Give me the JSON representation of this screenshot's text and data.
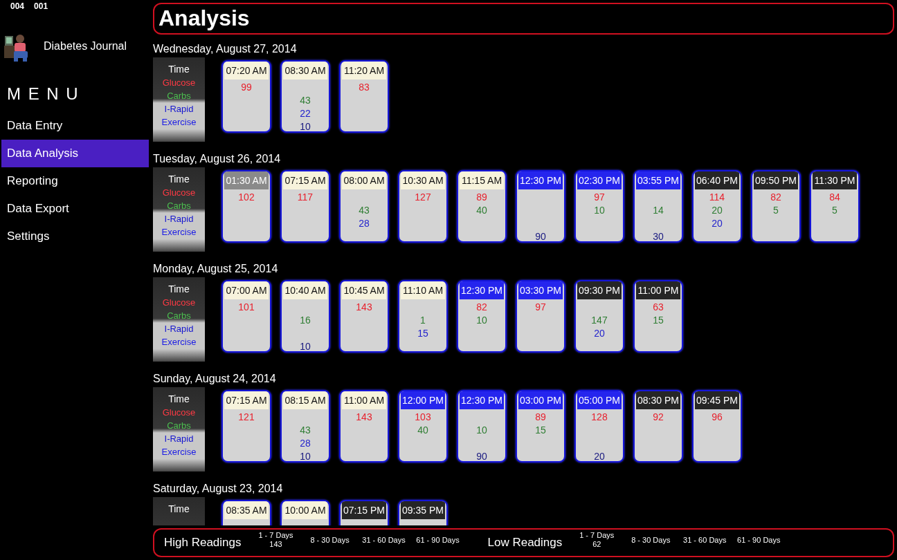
{
  "status_codes": [
    "004",
    "001"
  ],
  "app": {
    "title": "Diabetes Journal"
  },
  "menu": {
    "heading": "M E N U",
    "items": [
      {
        "label": "Data Entry",
        "selected": false
      },
      {
        "label": "Data Analysis",
        "selected": true
      },
      {
        "label": "Reporting",
        "selected": false
      },
      {
        "label": "Data Export",
        "selected": false
      },
      {
        "label": "Settings",
        "selected": false
      }
    ]
  },
  "page_title": "Analysis",
  "days": [
    {
      "date": "Wednesday, August 27, 2014",
      "legend": [
        {
          "kind": "time",
          "label": "Time"
        },
        {
          "kind": "glucose",
          "label": "Glucose"
        },
        {
          "kind": "carbs",
          "label": "Carbs"
        },
        {
          "kind": "irapid",
          "label": "I-Rapid"
        },
        {
          "kind": "exercise",
          "label": "Exercise"
        }
      ],
      "entries": [
        {
          "time": "07:20 AM",
          "kind": "morning",
          "glucose": "99"
        },
        {
          "time": "08:30 AM",
          "kind": "morning",
          "carbs": "43",
          "irapid": "22",
          "exercise": "10"
        },
        {
          "time": "11:20 AM",
          "kind": "morning",
          "glucose": "83"
        }
      ]
    },
    {
      "date": "Tuesday, August 26, 2014",
      "legend": [
        {
          "kind": "time",
          "label": "Time"
        },
        {
          "kind": "glucose",
          "label": "Glucose"
        },
        {
          "kind": "carbs",
          "label": "Carbs"
        },
        {
          "kind": "irapid",
          "label": "I-Rapid"
        },
        {
          "kind": "exercise",
          "label": "Exercise"
        }
      ],
      "entries": [
        {
          "time": "01:30 AM",
          "kind": "night",
          "glucose": "102"
        },
        {
          "time": "07:15 AM",
          "kind": "morning",
          "glucose": "117"
        },
        {
          "time": "08:00 AM",
          "kind": "morning",
          "carbs": "43",
          "irapid": "28"
        },
        {
          "time": "10:30 AM",
          "kind": "morning",
          "glucose": "127"
        },
        {
          "time": "11:15 AM",
          "kind": "morning",
          "glucose": "89",
          "carbs": "40"
        },
        {
          "time": "12:30 PM",
          "kind": "afternoon",
          "exercise": "90"
        },
        {
          "time": "02:30 PM",
          "kind": "afternoon",
          "glucose": "97",
          "carbs": "10"
        },
        {
          "time": "03:55 PM",
          "kind": "afternoon",
          "carbs": "14",
          "exercise": "30"
        },
        {
          "time": "06:40 PM",
          "kind": "evening",
          "glucose": "114",
          "carbs": "20",
          "irapid": "20"
        },
        {
          "time": "09:50 PM",
          "kind": "evening",
          "glucose": "82",
          "carbs": "5"
        },
        {
          "time": "11:30 PM",
          "kind": "evening",
          "glucose": "84",
          "carbs": "5"
        }
      ]
    },
    {
      "date": "Monday, August 25, 2014",
      "legend": [
        {
          "kind": "time",
          "label": "Time"
        },
        {
          "kind": "glucose",
          "label": "Glucose"
        },
        {
          "kind": "carbs",
          "label": "Carbs"
        },
        {
          "kind": "irapid",
          "label": "I-Rapid"
        },
        {
          "kind": "exercise",
          "label": "Exercise"
        }
      ],
      "entries": [
        {
          "time": "07:00 AM",
          "kind": "morning",
          "glucose": "101"
        },
        {
          "time": "10:40 AM",
          "kind": "morning",
          "carbs": "16",
          "exercise": "10"
        },
        {
          "time": "10:45 AM",
          "kind": "morning",
          "glucose": "143"
        },
        {
          "time": "11:10 AM",
          "kind": "morning",
          "carbs": "1",
          "irapid": "15"
        },
        {
          "time": "12:30 PM",
          "kind": "afternoon",
          "glucose": "82",
          "carbs": "10"
        },
        {
          "time": "03:30 PM",
          "kind": "afternoon",
          "glucose": "97"
        },
        {
          "time": "09:30 PM",
          "kind": "evening",
          "carbs": "147",
          "irapid": "20"
        },
        {
          "time": "11:00 PM",
          "kind": "evening",
          "glucose": "63",
          "carbs": "15"
        }
      ]
    },
    {
      "date": "Sunday, August 24, 2014",
      "legend": [
        {
          "kind": "time",
          "label": "Time"
        },
        {
          "kind": "glucose",
          "label": "Glucose"
        },
        {
          "kind": "carbs",
          "label": "Carbs"
        },
        {
          "kind": "irapid",
          "label": "I-Rapid"
        },
        {
          "kind": "exercise",
          "label": "Exercise"
        }
      ],
      "entries": [
        {
          "time": "07:15 AM",
          "kind": "morning",
          "glucose": "121"
        },
        {
          "time": "08:15 AM",
          "kind": "morning",
          "carbs": "43",
          "irapid": "28",
          "exercise": "10"
        },
        {
          "time": "11:00 AM",
          "kind": "morning",
          "glucose": "143"
        },
        {
          "time": "12:00 PM",
          "kind": "afternoon",
          "glucose": "103",
          "carbs": "40"
        },
        {
          "time": "12:30 PM",
          "kind": "afternoon",
          "carbs": "10",
          "exercise": "90"
        },
        {
          "time": "03:00 PM",
          "kind": "afternoon",
          "glucose": "89",
          "carbs": "15"
        },
        {
          "time": "05:00 PM",
          "kind": "afternoon",
          "glucose": "128",
          "exercise": "20"
        },
        {
          "time": "08:30 PM",
          "kind": "evening",
          "glucose": "92"
        },
        {
          "time": "09:45 PM",
          "kind": "evening",
          "glucose": "96"
        }
      ]
    },
    {
      "date": "Saturday, August 23, 2014",
      "legend": [
        {
          "kind": "time",
          "label": "Time"
        }
      ],
      "entries": [
        {
          "time": "08:35 AM",
          "kind": "morning"
        },
        {
          "time": "10:00 AM",
          "kind": "morning"
        },
        {
          "time": "07:15 PM",
          "kind": "evening"
        },
        {
          "time": "09:35 PM",
          "kind": "evening"
        }
      ]
    }
  ],
  "footer": {
    "groups": [
      {
        "label": "High Readings",
        "ranges": [
          {
            "label": "1 - 7 Days",
            "value": "143"
          },
          {
            "label": "8 - 30 Days"
          },
          {
            "label": "31 - 60 Days"
          },
          {
            "label": "61 - 90 Days"
          }
        ]
      },
      {
        "label": "Low Readings",
        "ranges": [
          {
            "label": "1 - 7 Days",
            "value": "62"
          },
          {
            "label": "8 - 30 Days"
          },
          {
            "label": "31 - 60 Days"
          },
          {
            "label": "61 - 90 Days"
          }
        ]
      }
    ]
  }
}
